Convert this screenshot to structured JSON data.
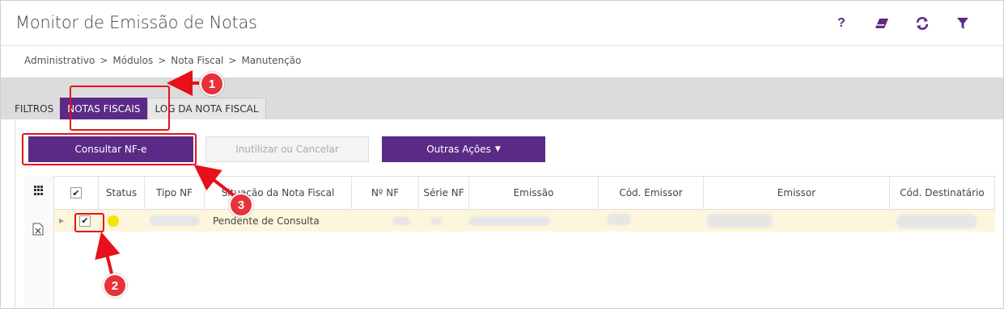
{
  "header": {
    "title": "Monitor de Emissão de Notas",
    "icons": [
      "help-icon",
      "eraser-icon",
      "refresh-icon",
      "filter-icon"
    ]
  },
  "breadcrumb": [
    "Administrativo",
    "Módulos",
    "Nota Fiscal",
    "Manutenção"
  ],
  "breadcrumb_sep": ">",
  "tabs": [
    {
      "label": "FILTROS",
      "active": false
    },
    {
      "label": "NOTAS FISCAIS",
      "active": true
    },
    {
      "label": "LOG DA NOTA FISCAL",
      "active": false
    }
  ],
  "actions": {
    "consult": "Consultar NF-e",
    "void_cancel": "Inutilizar ou Cancelar",
    "other": "Outras Ações"
  },
  "columns": [
    "Status",
    "Tipo NF",
    "Situação da Nota Fiscal",
    "Nº NF",
    "Série NF",
    "Emissão",
    "Cód. Emissor",
    "Emissor",
    "Cód. Destinatário"
  ],
  "rows": [
    {
      "checked": true,
      "status_color": "#f2e600",
      "situacao": "Pendente de Consulta"
    }
  ],
  "annotations": [
    "1",
    "2",
    "3"
  ],
  "colors": {
    "accent": "#5b2a86",
    "annotation": "#e8101a",
    "row_highlight": "#fdf6dc"
  }
}
